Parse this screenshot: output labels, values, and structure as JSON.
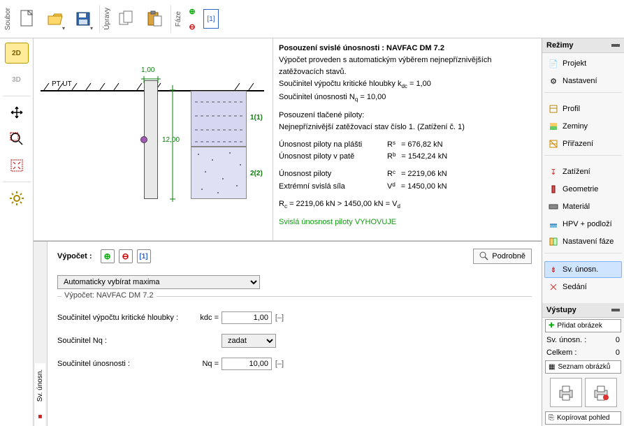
{
  "toolbar": {
    "group_file": "Soubor",
    "group_edit": "Úpravy",
    "group_phase": "Fáze",
    "phase_btn": "[1]"
  },
  "left": {
    "v2d": "2D",
    "v3d": "3D"
  },
  "sketch": {
    "pt_ut": "PT UT",
    "dim1": "1,00",
    "dim2": "12,00",
    "layer1": "1(1)",
    "layer2": "2(2)"
  },
  "results": {
    "title": "Posouzení svislé únosnosti : NAVFAC DM 7.2",
    "line1": "Výpočet proveden s automatickým výběrem nejnepříznivějších zatěžovacích stavů.",
    "kdc_lbl": "Součinitel výpočtu kritické hloubky k",
    "kdc_sub": "dc",
    "kdc_val": " = 1,00",
    "nq_lbl": "Součinitel únosnosti N",
    "nq_sub": "q",
    "nq_val": " = 10,00",
    "sec2a": "Posouzení tlačené piloty:",
    "sec2b": "Nejnepříznivější zatěžovací stav číslo 1. (Zatížení č. 1)",
    "r_shaft": "Únosnost piloty na plášti",
    "r_s_sym": "R",
    "r_s_sub": "s",
    "r_s_val": "=   676,82 kN",
    "r_base": "Únosnost piloty v patě",
    "r_b_sym": "R",
    "r_b_sub": "b",
    "r_b_val": "= 1542,24 kN",
    "r_total": "Únosnost piloty",
    "r_c_sym": "R",
    "r_c_sub": "c",
    "r_c_val": "= 2219,06 kN",
    "v_extreme": "Extrémní svislá síla",
    "v_d_sym": "V",
    "v_d_sub": "d",
    "v_d_val": "= 1450,00 kN",
    "check": "R",
    "check_sub": "c",
    "check_rest": " = 2219,06 kN > 1450,00 kN = V",
    "check_sub2": "d",
    "verdict": "Svislá únosnost piloty VYHOVUJE"
  },
  "bottom": {
    "tab": "Sv. únosn.",
    "vypocet": "Výpočet :",
    "detail": "Podrobně",
    "mode": "Automaticky vybírat maxima",
    "legend": "Výpočet: NAVFAC DM 7.2",
    "p1": "Součinitel výpočtu kritické hloubky :",
    "p1sym": "k",
    "p1sub": "dc",
    "p1eq": " =",
    "p1val": "1,00",
    "p1unit": "[–]",
    "p2": "Součinitel N",
    "p2sub": "q",
    "p2rest": " :",
    "p2mode": "zadat",
    "p3": "Součinitel únosnosti :",
    "p3sym": "N",
    "p3sub": "q",
    "p3eq": " =",
    "p3val": "10,00",
    "p3unit": "[–]"
  },
  "right": {
    "h_modes": "Režimy",
    "items": [
      "Projekt",
      "Nastavení",
      "Profil",
      "Zeminy",
      "Přiřazení",
      "Zatížení",
      "Geometrie",
      "Materiál",
      "HPV + podloží",
      "Nastavení fáze",
      "Sv. únosn.",
      "Sedání"
    ],
    "h_out": "Výstupy",
    "add_img": "Přidat obrázek",
    "out1": "Sv. únosn. :",
    "out1v": "0",
    "out2": "Celkem :",
    "out2v": "0",
    "list_img": "Seznam obrázků",
    "copy": "Kopírovat pohled"
  }
}
